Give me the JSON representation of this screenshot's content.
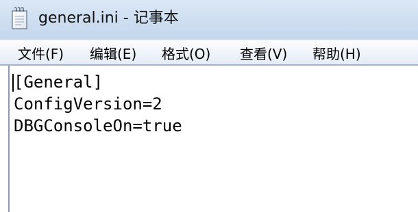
{
  "window": {
    "title": "general.ini - 记事本",
    "icon": "notepad-icon"
  },
  "menu": {
    "items": [
      {
        "label": "文件(F)"
      },
      {
        "label": "编辑(E)"
      },
      {
        "label": "格式(O)"
      },
      {
        "label": "查看(V)"
      },
      {
        "label": "帮助(H)"
      }
    ]
  },
  "editor": {
    "lines": [
      "[General]",
      "ConfigVersion=2",
      "DBGConsoleOn=true"
    ]
  }
}
